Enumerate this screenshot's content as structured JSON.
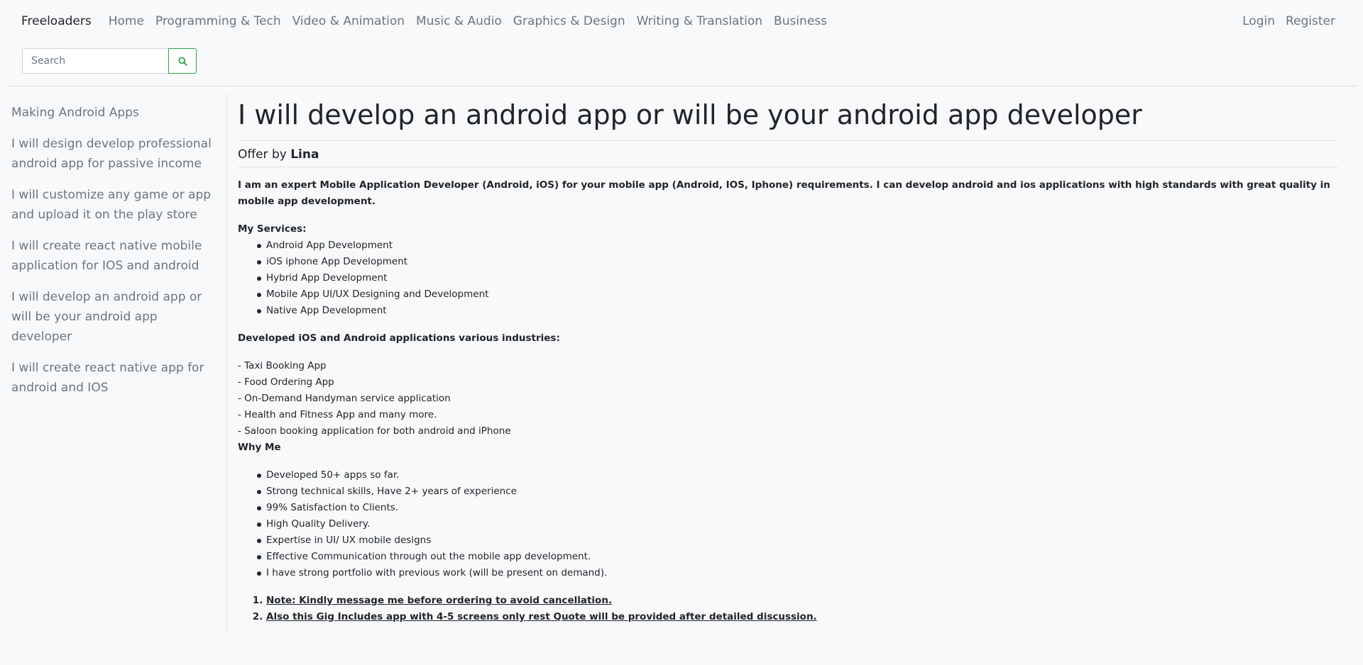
{
  "navbar": {
    "brand": "Freeloaders",
    "links": [
      "Home",
      "Programming & Tech",
      "Video & Animation",
      "Music & Audio",
      "Graphics & Design",
      "Writing & Translation",
      "Business"
    ],
    "login": "Login",
    "register": "Register"
  },
  "search": {
    "placeholder": "Search"
  },
  "sidebar": {
    "items": [
      "Making Android Apps",
      "I will design develop professional android app for passive income",
      "I will customize any game or app and upload it on the play store",
      "I will create react native mobile application for IOS and android",
      "I will develop an android app or will be your android app developer",
      "I will create react native app for android and IOS"
    ]
  },
  "gig": {
    "title": "I will develop an android app or will be your android app developer",
    "offer_prefix": "Offer by",
    "seller": "Lina",
    "intro": "I am an expert Mobile Application Developer (Android, iOS) for your mobile app (Android, IOS, Iphone)  requirements. I can develop android and ios applications with high standards with great quality in mobile app development.",
    "services_heading": "My Services:",
    "services": [
      "Android App Development",
      "iOS iphone App Development",
      "Hybrid App Development",
      "Mobile App UI/UX Designing and Development",
      "Native App Development"
    ],
    "industries_heading": "Developed iOS and Android applications various industries:",
    "industries": [
      "- Taxi Booking App",
      "- Food Ordering App",
      "- On-Demand Handyman service application",
      "- Health and Fitness App and many more.",
      "- Saloon booking application for both android and iPhone"
    ],
    "why_heading": "Why Me",
    "why": [
      "Developed 50+ apps so far.",
      "Strong technical skills, Have 2+ years of experience",
      "99% Satisfaction to Clients.",
      "High Quality Delivery.",
      "Expertise in UI/ UX mobile designs",
      "Effective Communication through out the mobile app development.",
      "I have strong portfolio with previous work (will be present on demand)."
    ],
    "notes": [
      "Note: Kindly message me before ordering to avoid cancellation.",
      "Also this Gig Includes app with 4-5 screens only rest Quote will be provided after detailed discussion."
    ]
  },
  "colors": {
    "accent": "#28a745",
    "muted": "#6c757d",
    "text": "#212529",
    "background": "#f8f9fa"
  }
}
